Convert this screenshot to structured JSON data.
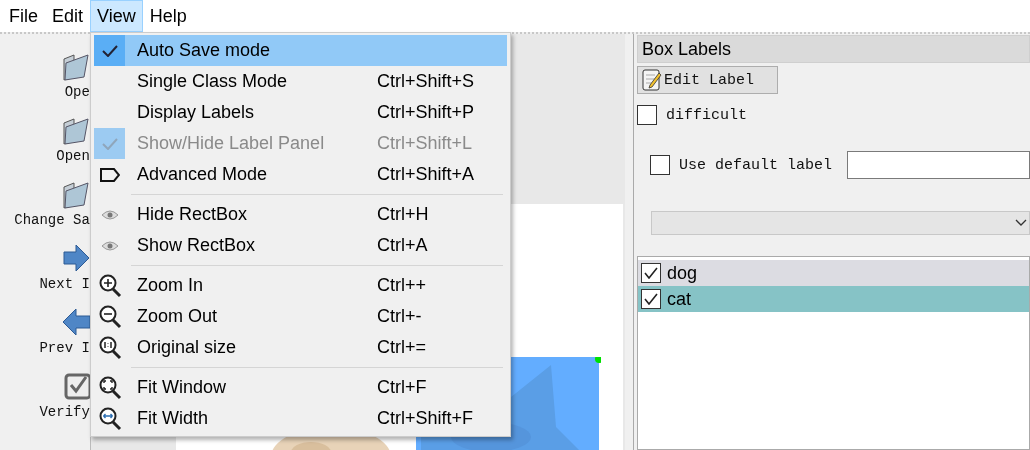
{
  "menubar": [
    {
      "label": "File",
      "selected": false
    },
    {
      "label": "Edit",
      "selected": false
    },
    {
      "label": "View",
      "selected": true
    },
    {
      "label": "Help",
      "selected": false
    }
  ],
  "toolbar": [
    {
      "label": "Ope",
      "kind": "folder"
    },
    {
      "label": "Open",
      "kind": "folder"
    },
    {
      "label": "Change Sa",
      "kind": "folder"
    },
    {
      "label": "Next I",
      "kind": "arrow-right"
    },
    {
      "label": "Prev I",
      "kind": "arrow-left"
    },
    {
      "label": "Verify",
      "kind": "verify"
    }
  ],
  "view_menu": [
    {
      "kind": "check",
      "label": "Auto Save mode",
      "checked": true,
      "disabled": false,
      "selected": true
    },
    {
      "kind": "plain",
      "label": "Single Class Mode",
      "shortcut": "Ctrl+Shift+S",
      "disabled": false,
      "selected": false
    },
    {
      "kind": "plain",
      "label": "Display Labels",
      "shortcut": "Ctrl+Shift+P",
      "disabled": false,
      "selected": false
    },
    {
      "kind": "check",
      "label": "Show/Hide Label Panel",
      "shortcut": "Ctrl+Shift+L",
      "checked": true,
      "disabled": true,
      "selected": false
    },
    {
      "kind": "tag",
      "label": "Advanced Mode",
      "shortcut": "Ctrl+Shift+A",
      "disabled": false,
      "selected": false
    },
    {
      "kind": "separator"
    },
    {
      "kind": "eye",
      "label": "Hide RectBox",
      "shortcut": "Ctrl+H",
      "disabled": false,
      "selected": false
    },
    {
      "kind": "eye",
      "label": "Show RectBox",
      "shortcut": "Ctrl+A",
      "disabled": false,
      "selected": false
    },
    {
      "kind": "separator"
    },
    {
      "kind": "zoom-in",
      "label": "Zoom In",
      "shortcut": "Ctrl++",
      "disabled": false,
      "selected": false
    },
    {
      "kind": "zoom-out",
      "label": "Zoom Out",
      "shortcut": "Ctrl+-",
      "disabled": false,
      "selected": false
    },
    {
      "kind": "zoom-original",
      "label": "Original size",
      "shortcut": "Ctrl+=",
      "disabled": false,
      "selected": false
    },
    {
      "kind": "separator"
    },
    {
      "kind": "fit-window",
      "label": "Fit Window",
      "shortcut": "Ctrl+F",
      "disabled": false,
      "selected": false
    },
    {
      "kind": "fit-width",
      "label": "Fit Width",
      "shortcut": "Ctrl+Shift+F",
      "disabled": false,
      "selected": false
    }
  ],
  "box_labels": {
    "title": "Box Labels",
    "edit_button": "Edit Label",
    "difficult": {
      "label": "difficult",
      "checked": false
    },
    "use_default": {
      "label": "Use default label",
      "checked": false
    },
    "labels": [
      {
        "label": "dog",
        "checked": true,
        "selected": false
      },
      {
        "label": "cat",
        "checked": true,
        "selected": true
      }
    ]
  }
}
